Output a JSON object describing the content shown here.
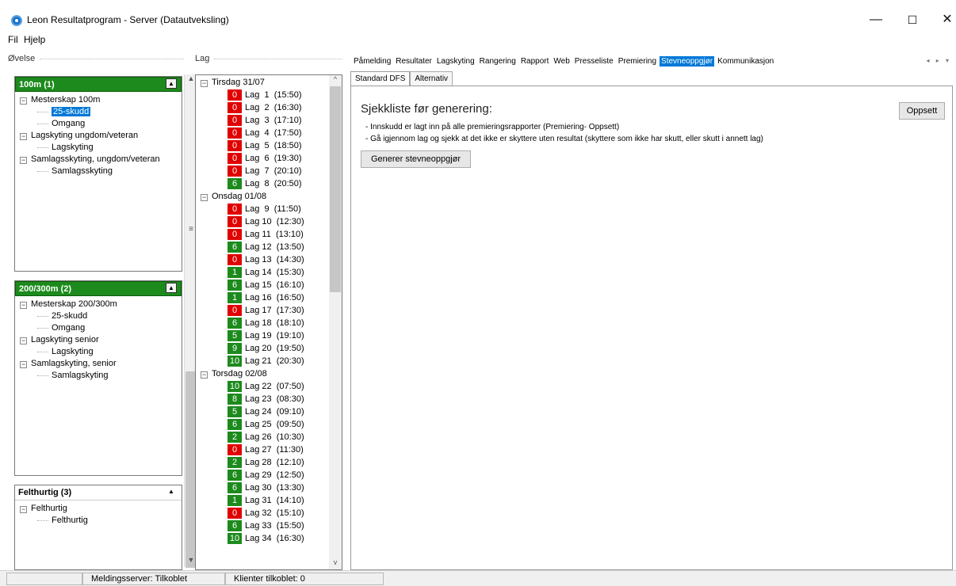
{
  "window": {
    "title": "Leon Resultatprogram - Server (Datautveksling)",
    "min": "—",
    "max": "☐",
    "close": "✕"
  },
  "menu": [
    "Fil",
    "Hjelp"
  ],
  "left": {
    "label": "Øvelse",
    "groups": [
      {
        "title": "100m (1)",
        "rows": [
          {
            "level": 1,
            "text": "Mesterskap 100m"
          },
          {
            "level": 2,
            "text": "25-skudd",
            "selected": true
          },
          {
            "level": 2,
            "text": "Omgang"
          },
          {
            "level": 1,
            "text": "Lagskyting ungdom/veteran"
          },
          {
            "level": 2,
            "text": "Lagskyting"
          },
          {
            "level": 1,
            "text": "Samlagsskyting, ungdom/veteran"
          },
          {
            "level": 2,
            "text": "Samlagsskyting"
          }
        ]
      },
      {
        "title": "200/300m (2)",
        "rows": [
          {
            "level": 1,
            "text": "Mesterskap 200/300m"
          },
          {
            "level": 2,
            "text": "25-skudd"
          },
          {
            "level": 2,
            "text": "Omgang"
          },
          {
            "level": 1,
            "text": "Lagskyting senior"
          },
          {
            "level": 2,
            "text": "Lagskyting"
          },
          {
            "level": 1,
            "text": "Samlagskyting, senior"
          },
          {
            "level": 2,
            "text": "Samlagskyting"
          }
        ]
      },
      {
        "title": "Felthurtig (3)",
        "rows": [
          {
            "level": 1,
            "text": "Felthurtig"
          },
          {
            "level": 2,
            "text": "Felthurtig"
          }
        ]
      }
    ]
  },
  "lag": {
    "label": "Lag",
    "items": [
      {
        "day": "Tirsdag 31/07"
      },
      {
        "count": "0",
        "label": "Lag  1  (15:50)",
        "status": "red"
      },
      {
        "count": "0",
        "label": "Lag  2  (16:30)",
        "status": "red"
      },
      {
        "count": "0",
        "label": "Lag  3  (17:10)",
        "status": "red"
      },
      {
        "count": "0",
        "label": "Lag  4  (17:50)",
        "status": "red"
      },
      {
        "count": "0",
        "label": "Lag  5  (18:50)",
        "status": "red"
      },
      {
        "count": "0",
        "label": "Lag  6  (19:30)",
        "status": "red"
      },
      {
        "count": "0",
        "label": "Lag  7  (20:10)",
        "status": "red"
      },
      {
        "count": "6",
        "label": "Lag  8  (20:50)",
        "status": "green"
      },
      {
        "day": "Onsdag 01/08"
      },
      {
        "count": "0",
        "label": "Lag  9  (11:50)",
        "status": "red"
      },
      {
        "count": "0",
        "label": "Lag 10  (12:30)",
        "status": "red"
      },
      {
        "count": "0",
        "label": "Lag 11  (13:10)",
        "status": "red"
      },
      {
        "count": "6",
        "label": "Lag 12  (13:50)",
        "status": "green"
      },
      {
        "count": "0",
        "label": "Lag 13  (14:30)",
        "status": "red"
      },
      {
        "count": "1",
        "label": "Lag 14  (15:30)",
        "status": "green"
      },
      {
        "count": "6",
        "label": "Lag 15  (16:10)",
        "status": "green"
      },
      {
        "count": "1",
        "label": "Lag 16  (16:50)",
        "status": "green"
      },
      {
        "count": "0",
        "label": "Lag 17  (17:30)",
        "status": "red"
      },
      {
        "count": "6",
        "label": "Lag 18  (18:10)",
        "status": "green"
      },
      {
        "count": "5",
        "label": "Lag 19  (19:10)",
        "status": "green"
      },
      {
        "count": "9",
        "label": "Lag 20  (19:50)",
        "status": "green"
      },
      {
        "count": "10",
        "label": "Lag 21  (20:30)",
        "status": "green"
      },
      {
        "day": "Torsdag 02/08"
      },
      {
        "count": "10",
        "label": "Lag 22  (07:50)",
        "status": "green"
      },
      {
        "count": "8",
        "label": "Lag 23  (08:30)",
        "status": "green"
      },
      {
        "count": "5",
        "label": "Lag 24  (09:10)",
        "status": "green"
      },
      {
        "count": "6",
        "label": "Lag 25  (09:50)",
        "status": "green"
      },
      {
        "count": "2",
        "label": "Lag 26  (10:30)",
        "status": "green"
      },
      {
        "count": "0",
        "label": "Lag 27  (11:30)",
        "status": "red"
      },
      {
        "count": "2",
        "label": "Lag 28  (12:10)",
        "status": "green"
      },
      {
        "count": "6",
        "label": "Lag 29  (12:50)",
        "status": "green"
      },
      {
        "count": "6",
        "label": "Lag 30  (13:30)",
        "status": "green"
      },
      {
        "count": "1",
        "label": "Lag 31  (14:10)",
        "status": "green"
      },
      {
        "count": "0",
        "label": "Lag 32  (15:10)",
        "status": "red"
      },
      {
        "count": "6",
        "label": "Lag 33  (15:50)",
        "status": "green"
      },
      {
        "count": "10",
        "label": "Lag 34  (16:30)",
        "status": "green"
      }
    ]
  },
  "tabs": {
    "items": [
      "Påmelding",
      "Resultater",
      "Lagskyting",
      "Rangering",
      "Rapport",
      "Web",
      "Presseliste",
      "Premiering",
      "Stevneoppgjør",
      "Kommunikasjon"
    ],
    "active": "Stevneoppgjør",
    "arrows": "◂ ▸ ▾"
  },
  "subtabs": {
    "items": [
      "Standard DFS",
      "Alternativ"
    ],
    "active": "Standard DFS"
  },
  "content": {
    "title": "Sjekkliste før generering:",
    "lines": [
      "- Innskudd er lagt inn på alle premieringsrapporter (Premiering- Oppsett)",
      "- Gå igjennom lag og sjekk at det ikke er skyttere uten resultat (skyttere som ikke har skutt, eller skutt i annett lag)"
    ],
    "generate_button": "Generer stevneoppgjør",
    "setup_button": "Oppsett"
  },
  "status": {
    "server": "Meldingsserver: Tilkoblet",
    "clients": "Klienter tilkoblet: 0"
  },
  "colors": {
    "accent": "#0078d7",
    "group_header": "#1c8a1c",
    "badge_red": "#e00000",
    "badge_green": "#1c8a1c"
  }
}
